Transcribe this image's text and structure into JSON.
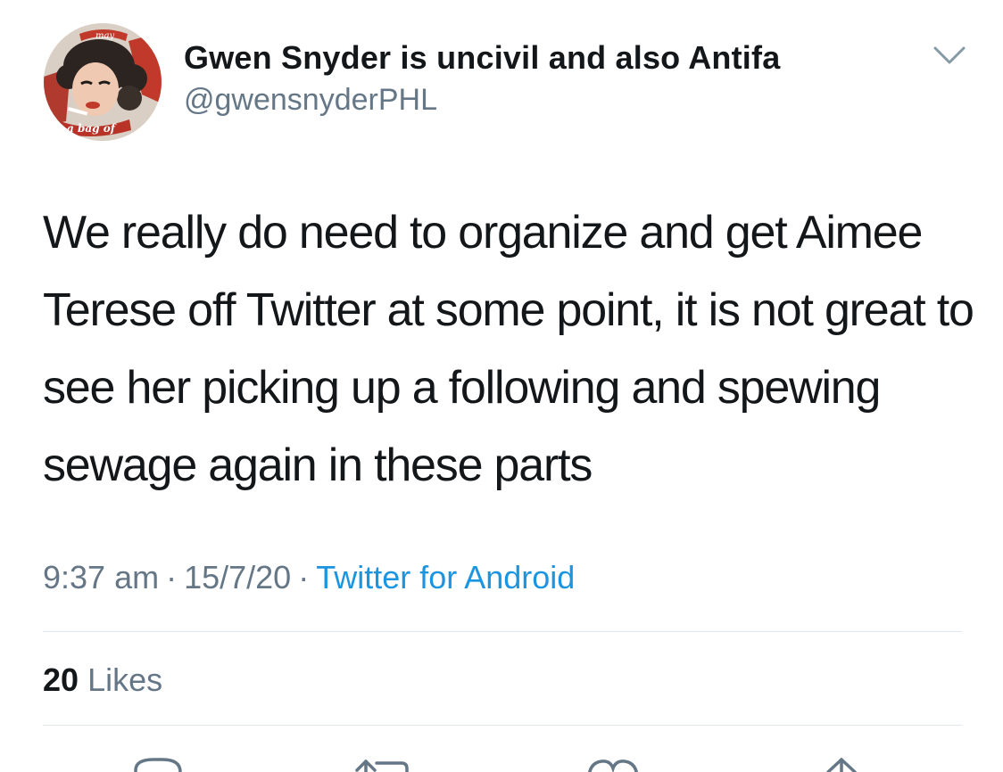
{
  "tweet": {
    "author": {
      "display_name": "Gwen Snyder is uncivil and also Antifa",
      "handle": "@gwensnyderPHL",
      "avatar_text_top": "may",
      "avatar_text_bottom": "a bag of"
    },
    "text": "We really do need to organize and get Aimee Terese off Twitter at some point, it is not great to see her picking up a following and spewing sewage again in these parts",
    "time": "9:37 am",
    "separator": "·",
    "date": "15/7/20",
    "source": "Twitter for Android",
    "likes_count": "20",
    "likes_label": "Likes"
  },
  "icons": {
    "more": "chevron-down-icon",
    "reply": "reply-icon",
    "retweet": "retweet-icon",
    "like": "heart-icon",
    "share": "share-icon"
  },
  "colors": {
    "text": "#14171a",
    "secondary": "#657786",
    "link": "#1b95e0",
    "divider": "#e1e8ed"
  }
}
